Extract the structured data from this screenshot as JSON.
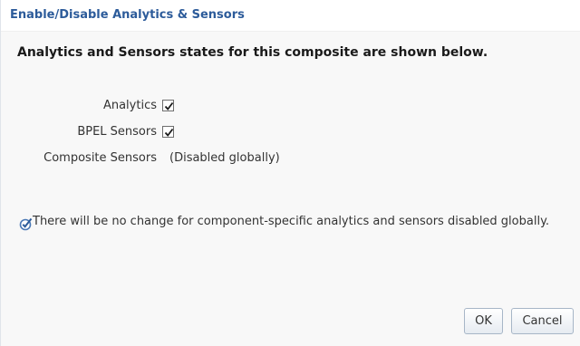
{
  "dialog": {
    "title": "Enable/Disable Analytics & Sensors",
    "heading": "Analytics and Sensors states for this composite are shown below."
  },
  "settings": [
    {
      "label": "Analytics",
      "checked": true
    },
    {
      "label": "BPEL Sensors",
      "checked": true
    },
    {
      "label": "Composite Sensors",
      "value": "(Disabled globally)"
    }
  ],
  "info": {
    "icon": "check-info-icon",
    "text": "There will be no change for component-specific analytics and sensors disabled globally."
  },
  "buttons": {
    "ok_label": "OK",
    "cancel_label": "Cancel"
  },
  "colors": {
    "title": "#2c5b9a",
    "background": "#f8f8f8",
    "button_border": "#a7b6c7"
  }
}
